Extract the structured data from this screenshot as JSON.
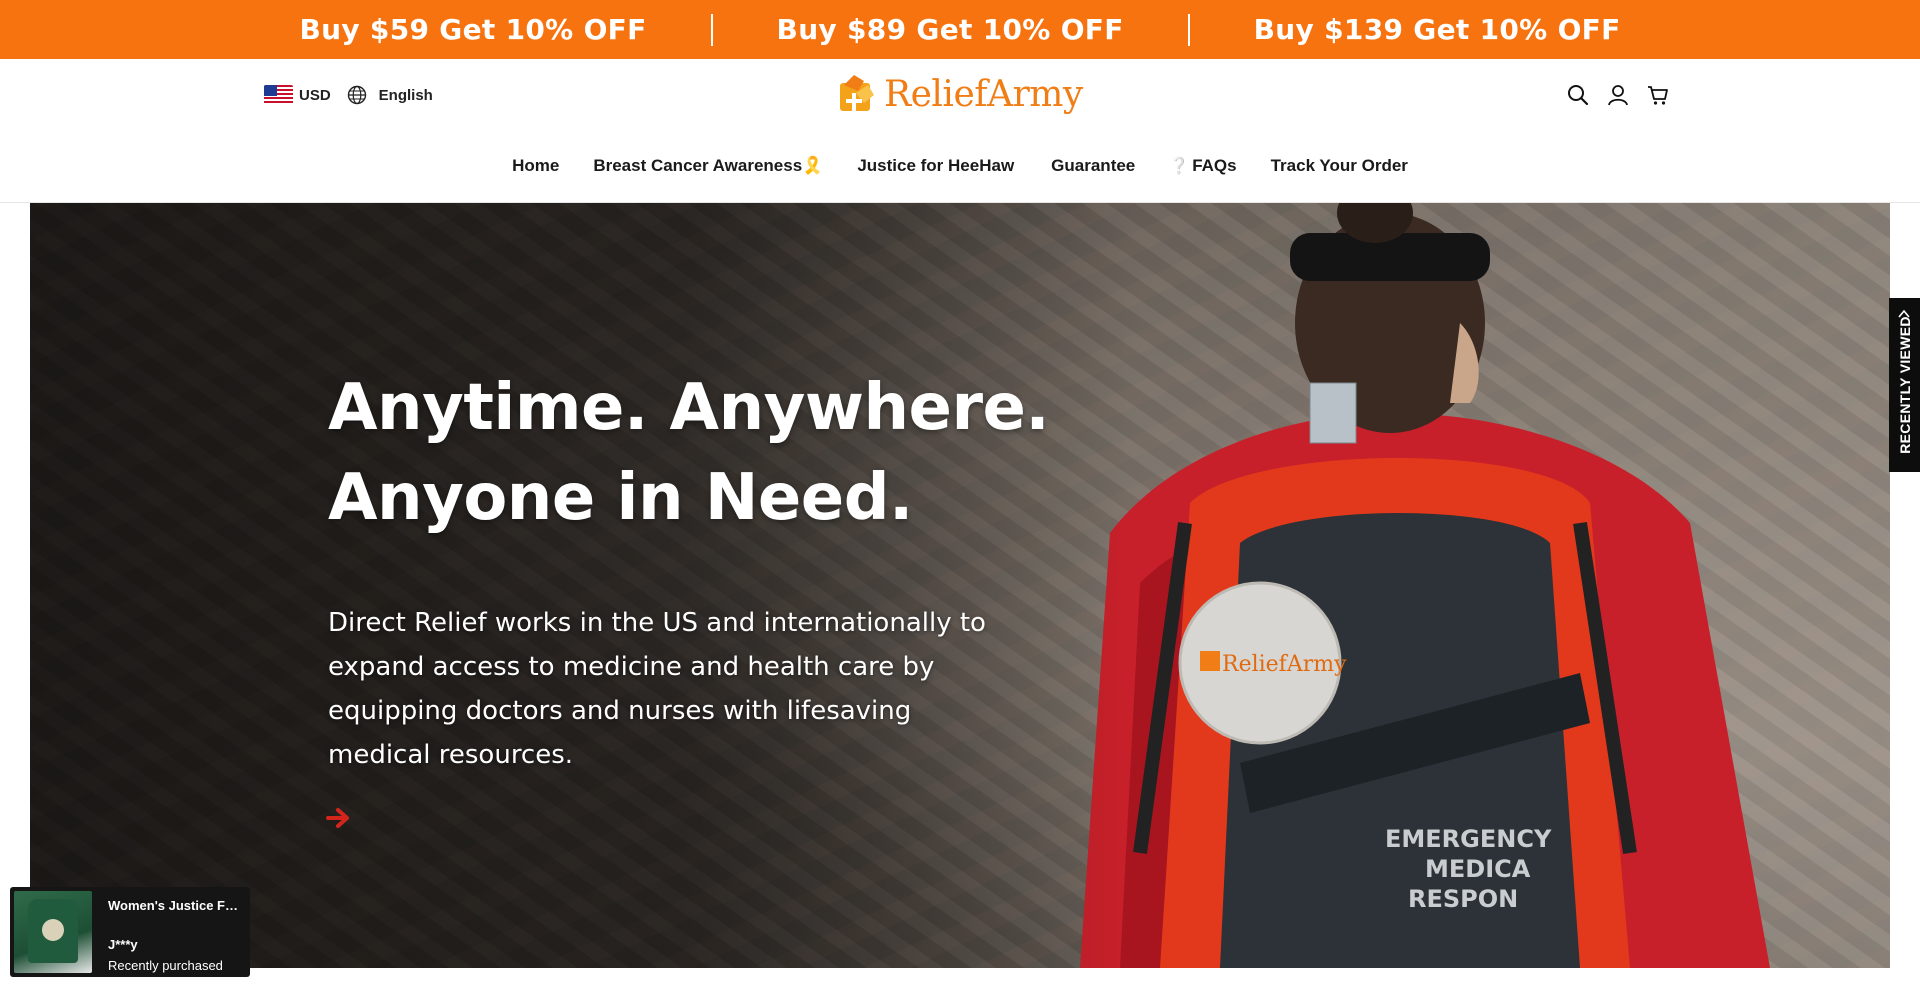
{
  "promo": {
    "items": [
      "Buy $59 Get 10% OFF",
      "Buy $89 Get 10% OFF",
      "Buy $139 Get 10% OFF"
    ],
    "background": "#f7730f"
  },
  "header": {
    "currency": "USD",
    "language": "English",
    "logo_text": "ReliefArmy",
    "icons": [
      "search-icon",
      "account-icon",
      "cart-icon"
    ]
  },
  "nav": {
    "items": [
      {
        "label": "Home",
        "emoji": ""
      },
      {
        "label": "Breast Cancer Awareness🎗️",
        "emoji": ""
      },
      {
        "label": "Justice for HeeHaw",
        "emoji": ""
      },
      {
        "label": "Guarantee",
        "emoji": ""
      },
      {
        "label": "FAQs",
        "emoji": "❔"
      },
      {
        "label": "Track Your Order",
        "emoji": ""
      }
    ]
  },
  "hero": {
    "title_line1": "Anytime. Anywhere.",
    "title_line2": "Anyone in Need.",
    "body": "Direct Relief works in the US and internationally to expand access to medicine and health care by equipping doctors and nurses with lifesaving medical resources.",
    "patch_text": "ReliefArmy",
    "bag_text_line1": "EMERGENCY",
    "bag_text_line2": "MEDICA",
    "bag_text_line3": "RESPON"
  },
  "recently_viewed": {
    "label": "RECENTLY VIEWED"
  },
  "popup": {
    "title": "Women's Justice For...",
    "name": "J***y",
    "status": "Recently purchased"
  },
  "colors": {
    "accent": "#f7730f",
    "logo": "#f07d15"
  }
}
